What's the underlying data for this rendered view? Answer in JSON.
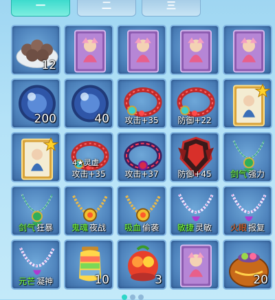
{
  "tabs": [
    {
      "label": "一",
      "active": true
    },
    {
      "label": "二",
      "active": false
    },
    {
      "label": "三",
      "active": false
    }
  ],
  "items": [
    {
      "icon": "meatball-plate-icon",
      "count": "12"
    },
    {
      "icon": "pet-card-icon"
    },
    {
      "icon": "pet-card-icon"
    },
    {
      "icon": "pet-card-icon"
    },
    {
      "icon": "pet-card-icon"
    },
    {
      "icon": "crystal-orb-icon",
      "count": "200"
    },
    {
      "icon": "crystal-orb-icon",
      "count": "40"
    },
    {
      "icon": "bracelet-icon",
      "stat": "攻击+35"
    },
    {
      "icon": "bracelet-icon",
      "stat": "防御+22"
    },
    {
      "icon": "star-pet-card-icon"
    },
    {
      "icon": "star-pet-card-icon"
    },
    {
      "icon": "bracelet-icon",
      "stat": "攻击+35",
      "badge": "4★灵虚"
    },
    {
      "icon": "dark-bracelet-icon",
      "stat": "攻击+37"
    },
    {
      "icon": "armor-icon",
      "stat": "防御+45"
    },
    {
      "icon": "necklace-icon",
      "attr": "剑气",
      "attr_suffix": "强力"
    },
    {
      "icon": "necklace-icon",
      "attr": "剑气",
      "attr_suffix": "狂暴"
    },
    {
      "icon": "gold-necklace-icon",
      "attr": "鬼魂",
      "attr_suffix": "夜战"
    },
    {
      "icon": "gold-necklace-icon",
      "attr": "吸血",
      "attr_suffix": "偷袭"
    },
    {
      "icon": "pearl-necklace-icon",
      "attr": "敏捷",
      "attr_suffix": "灵敏"
    },
    {
      "icon": "pearl-necklace-icon",
      "attr": "火眼",
      "attr_suffix": "报复",
      "attr_color": "red"
    },
    {
      "icon": "pearl-necklace-icon",
      "attr": "元芒",
      "attr_suffix": "凝神"
    },
    {
      "icon": "rainbow-lantern-icon",
      "count": "10"
    },
    {
      "icon": "fruit-basket-icon",
      "count": "3"
    },
    {
      "icon": "pet-card-icon"
    },
    {
      "icon": "treasure-pot-icon",
      "count": "20"
    }
  ],
  "colors": {
    "tab_active": "#29d5c7",
    "slot_bg": "#4f84bd",
    "attr_green": "#7cff3a",
    "attr_red": "#ff5a2a"
  }
}
